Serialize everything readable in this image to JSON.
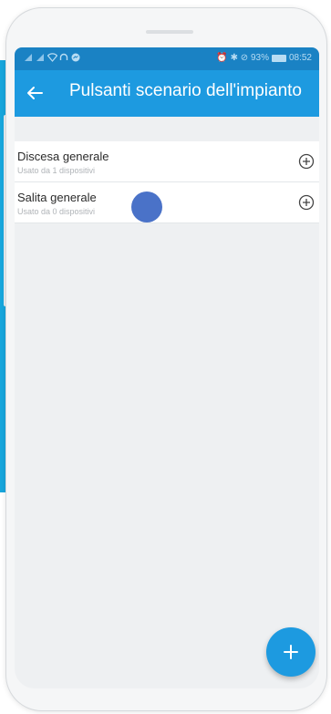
{
  "status_bar": {
    "right_text": "⏰ ✱ ⊘ 93%",
    "time": "08:52",
    "icons": [
      "signal-icon",
      "wifi-icon",
      "headset-icon",
      "messenger-icon",
      "alarm-icon",
      "bluetooth-icon",
      "mute-icon",
      "battery-icon"
    ]
  },
  "app_bar": {
    "title": "Pulsanti scenario dell'impianto",
    "back_icon": "arrow-left-icon",
    "color": "#1d9ae0"
  },
  "list": {
    "items": [
      {
        "title": "Discesa generale",
        "subtitle": "Usato da 1 dispositivi",
        "action_icon": "circle-plus-icon"
      },
      {
        "title": "Salita generale",
        "subtitle": "Usato da 0 dispositivi",
        "action_icon": "circle-plus-icon"
      }
    ]
  },
  "fab": {
    "icon": "plus-icon",
    "color": "#1d9ae0"
  }
}
